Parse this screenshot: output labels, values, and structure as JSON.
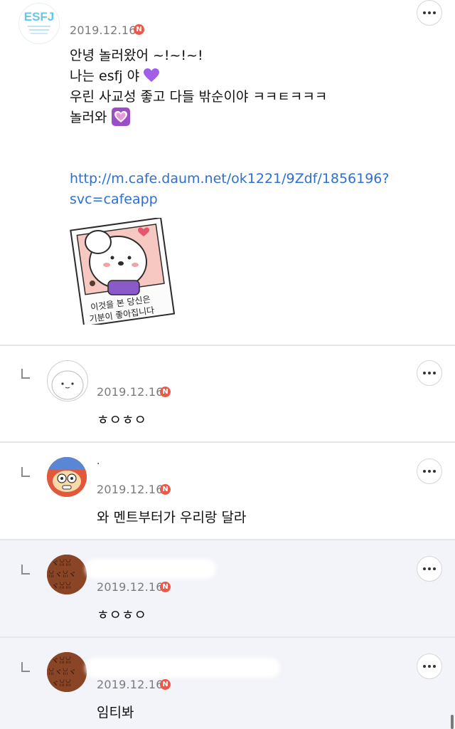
{
  "post": {
    "author_name": "",
    "date": "2019.12.16",
    "new_badge": "N",
    "avatar_text": "ESFJ",
    "lines": [
      "안녕 놀러왔어 ~!~!~!",
      "나는 esfj 야",
      "우린 사교성 좋고 다들 밖순이야 ㅋㅋㅌㅋㅋㅋ",
      "놀러와"
    ],
    "link_line1": "http://m.cafe.daum.net/ok1221/9Zdf/1856196?",
    "link_line2": "svc=cafeapp",
    "sticker_text_line1": "이것을 본 당신은",
    "sticker_text_line2": "기분이 좋아집니다"
  },
  "replies": [
    {
      "author": "",
      "date": "2019.12.16",
      "badge": "N",
      "text": "ㅎㅇㅎㅇ"
    },
    {
      "author": ".",
      "date": "2019.12.16",
      "badge": "N",
      "text": "와 멘트부터가 우리랑 달라"
    },
    {
      "author": "",
      "date": "2019.12.16",
      "badge": "N",
      "text": "ㅎㅇㅎㅇ"
    },
    {
      "author": "",
      "date": "2019.12.16",
      "badge": "N",
      "text": "임티봐"
    }
  ],
  "colors": {
    "badge": "#ea5a4b",
    "link": "#2e6fd1",
    "shaded_row": "#f3f4f9",
    "divider": "#e6e6ea"
  },
  "icons": [
    "more-options-icon",
    "reply-arrow-icon",
    "purple-heart-icon",
    "heart-decoration-icon"
  ]
}
